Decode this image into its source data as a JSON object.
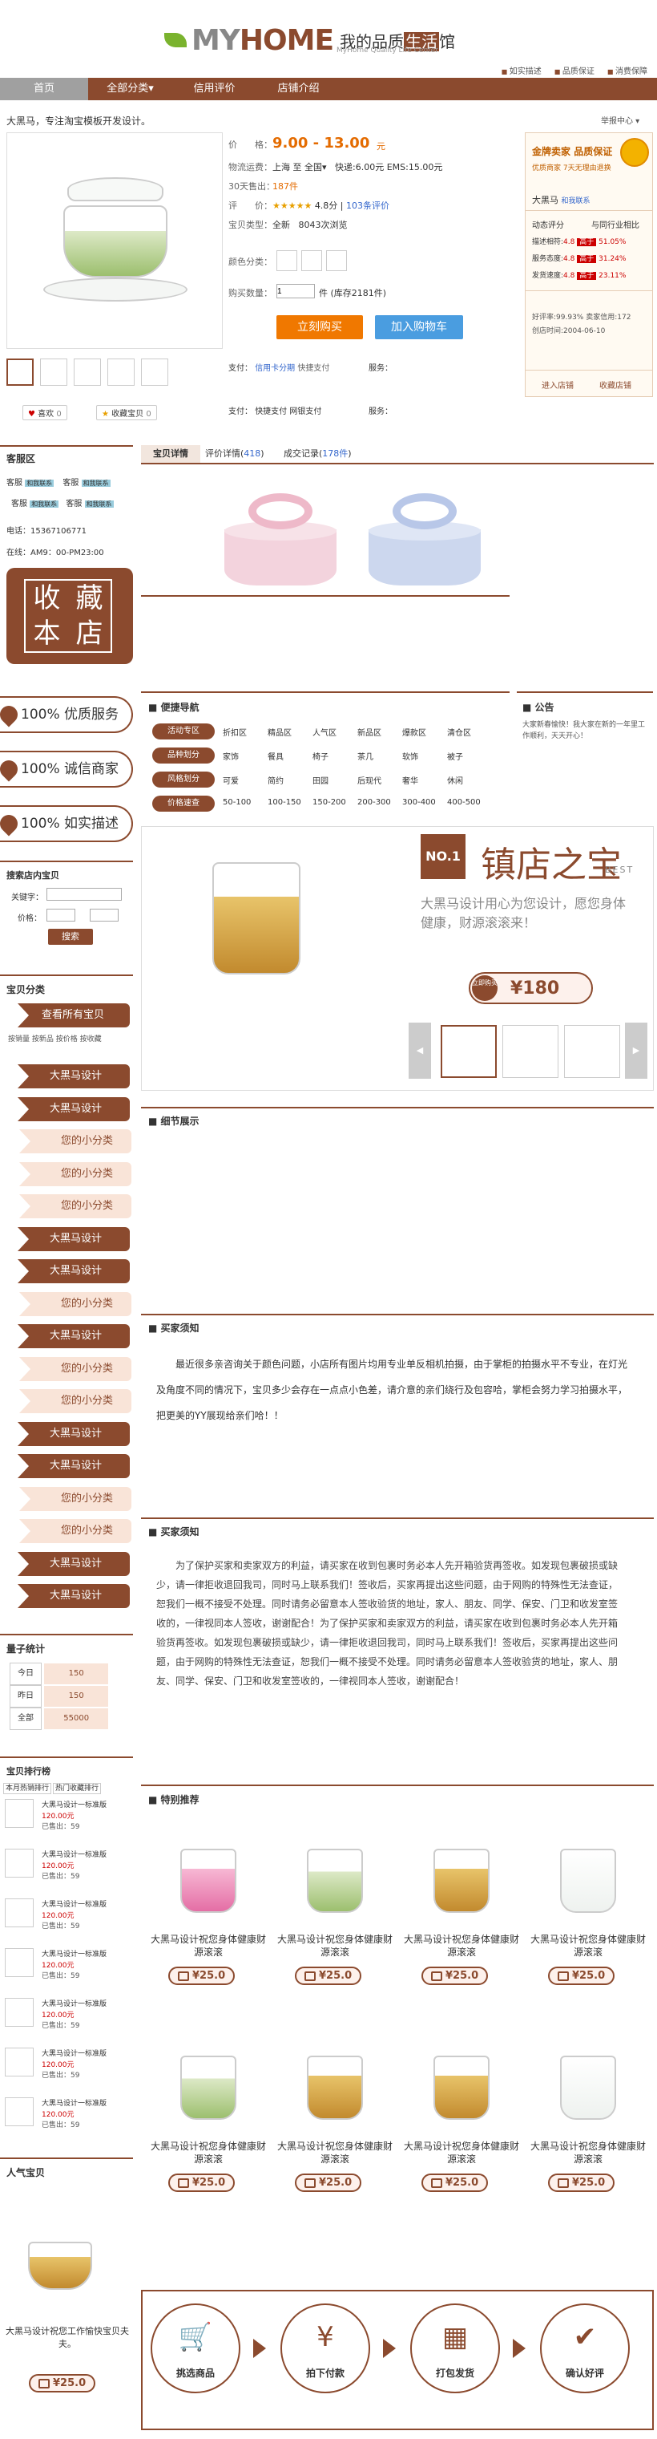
{
  "header": {
    "brand_my": "MY",
    "brand_home": "HOME",
    "brand_cn_a": "我的品质",
    "brand_cn_b": "生活",
    "brand_cn_c": "馆",
    "brand_sub": "MyHome Quality Life Center",
    "links": [
      "如实描述",
      "品质保证",
      "消费保障"
    ]
  },
  "nav": [
    "首页",
    "全部分类▾",
    "信用评价",
    "店铺介绍"
  ],
  "item": {
    "title": "大黑马，专注淘宝模板开发设计。",
    "price_label": "价　　格：",
    "price": "9.00 - 13.00",
    "price_unit": "元",
    "ship_label": "物流运费：",
    "ship_from": "上海",
    "ship_to": "至 全国▾",
    "ship_detail": "快递:6.00元 EMS:15.00元",
    "sold_label": "30天售出：",
    "sold": "187件",
    "rating_label": "评　　价：",
    "rating_score": "4.8分",
    "rating_count": "103条评价",
    "type_label": "宝贝类型：",
    "type": "全新",
    "type_extra": "8043次浏览",
    "color_label": "颜色分类：",
    "qty_label": "购买数量：",
    "qty": "1",
    "stock": "件 (库存2181件)",
    "buy_now": "立刻购买",
    "add_cart": "加入购物车",
    "pay_label": "支付：",
    "pay_methods": [
      "信用卡分期",
      "快捷支付"
    ],
    "service_label": "服务：",
    "fav": "喜欢",
    "fav_count": "0",
    "collect": "收藏宝贝",
    "collect_count": "0",
    "pay2_label": "支付：",
    "pay2": "快捷支付",
    "pay2b": "网银支付"
  },
  "seller": {
    "badge1": "金牌卖家",
    "badge2": "品质保证",
    "subtitle": "优质商家 7天无理由退换",
    "name": "大黑马",
    "tag": "和我联系",
    "dyn_title": "动态评分",
    "cmp_title": "与同行业相比",
    "rows": [
      {
        "label": "描述相符:",
        "score": "4.8",
        "tag": "高于",
        "pct": "51.05%"
      },
      {
        "label": "服务态度:",
        "score": "4.8",
        "tag": "高于",
        "pct": "31.24%"
      },
      {
        "label": "发货速度:",
        "score": "4.8",
        "tag": "高于",
        "pct": "23.11%"
      }
    ],
    "good_rate": "好评率:99.93%",
    "credit": "卖家信用:172",
    "created": "创店时间:2004-06-10",
    "enter": "进入店铺",
    "collect": "收藏店铺"
  },
  "left": {
    "kefu_title": "客服区",
    "kefu_items": [
      "客服",
      "客服",
      "客服",
      "客服",
      "客服"
    ],
    "kefu_tag": "和我联系",
    "phone": "电话：15367106771",
    "online": "在线：AM9：00-PM23:00",
    "collect_box": [
      "收",
      "藏",
      "本",
      "店"
    ],
    "services": [
      "100% 优质服务",
      "100% 诚信商家",
      "100% 如实描述"
    ],
    "search_title": "搜索店内宝贝",
    "kw_label": "关键字：",
    "price_label": "价格：",
    "search_btn": "搜索",
    "cat_title": "宝贝分类",
    "cat_all": "查看所有宝贝",
    "cat_sort": [
      "按销量",
      "按新品",
      "按价格",
      "按收藏"
    ],
    "cats": [
      {
        "t": "main",
        "l": "大黑马设计"
      },
      {
        "t": "main",
        "l": "大黑马设计"
      },
      {
        "t": "sub",
        "l": "您的小分类"
      },
      {
        "t": "sub",
        "l": "您的小分类"
      },
      {
        "t": "sub",
        "l": "您的小分类"
      },
      {
        "t": "main",
        "l": "大黑马设计"
      },
      {
        "t": "main",
        "l": "大黑马设计"
      },
      {
        "t": "sub",
        "l": "您的小分类"
      },
      {
        "t": "main",
        "l": "大黑马设计"
      },
      {
        "t": "sub",
        "l": "您的小分类"
      },
      {
        "t": "sub",
        "l": "您的小分类"
      },
      {
        "t": "main",
        "l": "大黑马设计"
      },
      {
        "t": "main",
        "l": "大黑马设计"
      },
      {
        "t": "sub",
        "l": "您的小分类"
      },
      {
        "t": "sub",
        "l": "您的小分类"
      },
      {
        "t": "main",
        "l": "大黑马设计"
      },
      {
        "t": "main",
        "l": "大黑马设计"
      }
    ],
    "stats_title": "量子统计",
    "stats": [
      {
        "l": "今日",
        "v": "150"
      },
      {
        "l": "昨日",
        "v": "150"
      },
      {
        "l": "全部",
        "v": "55000"
      }
    ],
    "rank_title": "宝贝排行榜",
    "rank_tabs": [
      "本月热销排行",
      "热门收藏排行"
    ],
    "rank_name": "大黑马设计一标准版",
    "rank_price": "120.00元",
    "rank_sold": "已售出：59",
    "hot_title": "人气宝贝",
    "hot_name": "大黑马设计祝您工作愉快宝贝夫夫。",
    "hot_price": "¥25.0"
  },
  "tabs": [
    {
      "label": "宝贝详情",
      "count": ""
    },
    {
      "label": "评价详情",
      "count": "418"
    },
    {
      "label": "成交记录",
      "count": "178件"
    }
  ],
  "quicknav": {
    "title": "便捷导航",
    "tags": [
      "活动专区",
      "品种划分",
      "风格划分",
      "价格速查"
    ],
    "rows": [
      [
        "折扣区",
        "精品区",
        "人气区",
        "新品区",
        "爆款区",
        "清仓区"
      ],
      [
        "家饰",
        "餐具",
        "椅子",
        "茶几",
        "软饰",
        "被子"
      ],
      [
        "可爱",
        "简约",
        "田园",
        "后现代",
        "奢华",
        "休闲"
      ],
      [
        "50-100",
        "100-150",
        "150-200",
        "200-300",
        "300-400",
        "400-500"
      ]
    ]
  },
  "notice": {
    "title": "公告",
    "text": "大家新春愉快！我大家在新的一年里工作顺利，天天开心！"
  },
  "banner": {
    "no": "NO.1",
    "title": "镇店之宝",
    "best": "BEST",
    "desc": "大黑马设计用心为您设计，愿您身体健康，财源滚滚来！",
    "buy": "立即购买",
    "price": "¥180"
  },
  "detail": {
    "title": "细节展示"
  },
  "notes1": {
    "title": "买家须知",
    "text": "最近很多亲咨询关于颜色问题，小店所有图片均用专业单反相机拍摄，由于掌柜的拍摄水平不专业，在灯光及角度不同的情况下，宝贝多少会存在一点点小色差，请介意的亲们绕行及包容哈，掌柜会努力学习拍摄水平，把更美的YY展现给亲们哈！！"
  },
  "notes2": {
    "title": "买家须知",
    "text": "为了保护买家和卖家双方的利益，请买家在收到包裹时务必本人先开箱验货再签收。如发现包裹破损或缺少，请一律拒收退回我司，同时马上联系我们！签收后，买家再提出这些问题，由于网购的特殊性无法查证，恕我们一概不接受不处理。同时请务必留意本人签收验货的地址，家人、朋友、同学、保安、门卫和收发室签收的，一律视同本人签收，谢谢配合！为了保护买家和卖家双方的利益，请买家在收到包裹时务必本人先开箱验货再签收。如发现包裹破损或缺少，请一律拒收退回我司，同时马上联系我们！签收后，买家再提出这些问题，由于网购的特殊性无法查证，恕我们一概不接受不处理。同时请务必留意本人签收验货的地址，家人、朋友、同学、保安、门卫和收发室签收的，一律视同本人签收，谢谢配合！"
  },
  "recommend": {
    "title": "特别推荐",
    "name": "大黑马设计祝您身体健康财源滚滚",
    "price": "¥25.0"
  },
  "steps": [
    "挑选商品",
    "拍下付款",
    "打包发货",
    "确认好评"
  ]
}
